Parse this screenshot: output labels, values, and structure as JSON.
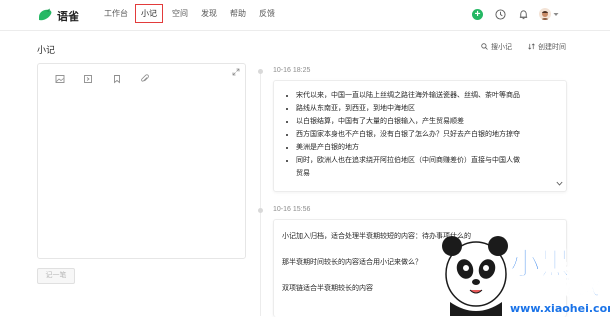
{
  "app": {
    "name": "语雀"
  },
  "nav": {
    "items": [
      "工作台",
      "小记",
      "空间",
      "发现",
      "帮助",
      "反馈"
    ],
    "active_index": 1
  },
  "page": {
    "title": "小记"
  },
  "editor": {
    "submit_label": "记一笔"
  },
  "header": {
    "search_label": "搜小记",
    "sort_label": "创建时间"
  },
  "notes": [
    {
      "time": "10-16 18:25",
      "bullets": [
        "宋代以来，中国一直以陆上丝绸之路往海外输送瓷器、丝绸、茶叶等商品",
        "路线从东南亚，到西亚，到地中海地区",
        "以白银结算，中国有了大量的白银输入，产生贸易顺差",
        "西方国家本身也不产白银，没有白银了怎么办？只好去产白银的地方掠夺",
        "美洲是产白银的地方",
        "同时，欧洲人也在追求绕开阿拉伯地区（中间商赚差价）直接与中国人做",
        "贸易"
      ]
    },
    {
      "time": "10-16 15:56",
      "paragraphs": [
        "小记加入归档，适合处理半衰期较短的内容：待办事项什么的",
        "那半衰期时间较长的内容适合用小记来做么？",
        "双项链适合半衰期较长的内容"
      ]
    }
  ],
  "watermark": {
    "text": "小黑游戏",
    "url": "www.xiaohei.com"
  },
  "colors": {
    "brand": "#25b864",
    "highlight_box": "#e23b3b",
    "watermark_blue": "#1a73e8"
  }
}
